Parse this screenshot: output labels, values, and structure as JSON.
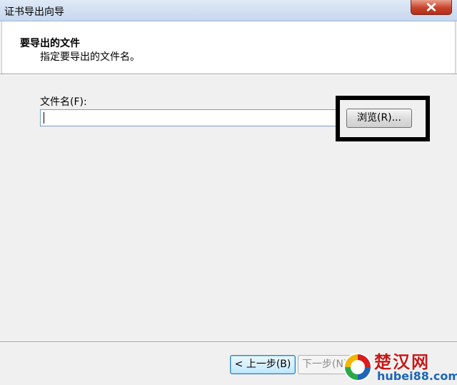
{
  "window": {
    "title": "证书导出向导"
  },
  "header": {
    "heading": "要导出的文件",
    "subheading": "指定要导出的文件名。"
  },
  "form": {
    "file_label": "文件名(F):",
    "file_value": "",
    "browse_label": "浏览(R)..."
  },
  "footer": {
    "back_label": "< 上一步(B)",
    "next_label": "下一步(N) >"
  },
  "watermark": {
    "title": "楚汉网",
    "url": "hubei88.com"
  },
  "colors": {
    "close_button": "#c8432b",
    "highlight_box": "#000000",
    "watermark_red": "#c31b1b",
    "watermark_blue": "#1d66b6"
  },
  "icons": [
    "close-icon",
    "watermark-logo-icon"
  ]
}
